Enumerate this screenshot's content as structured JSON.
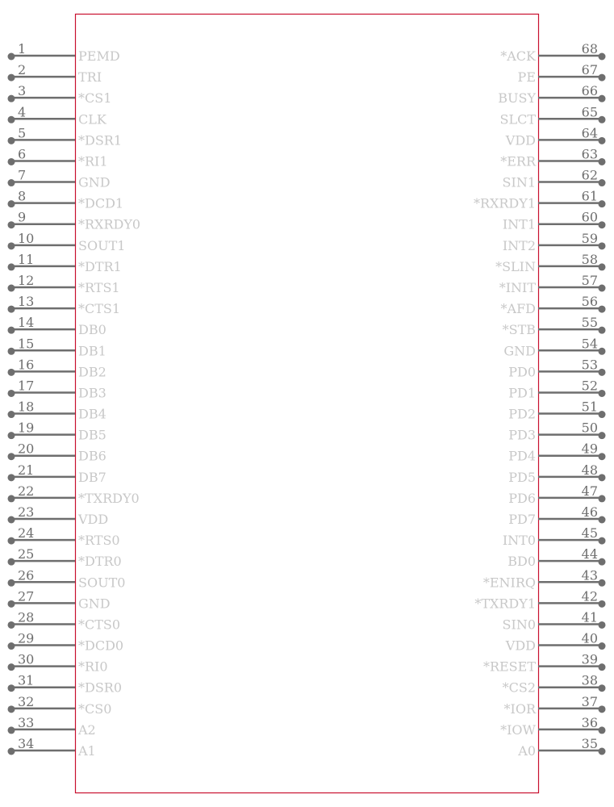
{
  "component": {
    "body_color": "#c8102e",
    "pin_color": "#6e6e6e",
    "label_color": "#c8c8c8",
    "left_pins": [
      {
        "num": "1",
        "name": "PEMD"
      },
      {
        "num": "2",
        "name": "TRI"
      },
      {
        "num": "3",
        "name": "*CS1"
      },
      {
        "num": "4",
        "name": "CLK"
      },
      {
        "num": "5",
        "name": "*DSR1"
      },
      {
        "num": "6",
        "name": "*RI1"
      },
      {
        "num": "7",
        "name": "GND"
      },
      {
        "num": "8",
        "name": "*DCD1"
      },
      {
        "num": "9",
        "name": "*RXRDY0"
      },
      {
        "num": "10",
        "name": "SOUT1"
      },
      {
        "num": "11",
        "name": "*DTR1"
      },
      {
        "num": "12",
        "name": "*RTS1"
      },
      {
        "num": "13",
        "name": "*CTS1"
      },
      {
        "num": "14",
        "name": "DB0"
      },
      {
        "num": "15",
        "name": "DB1"
      },
      {
        "num": "16",
        "name": "DB2"
      },
      {
        "num": "17",
        "name": "DB3"
      },
      {
        "num": "18",
        "name": "DB4"
      },
      {
        "num": "19",
        "name": "DB5"
      },
      {
        "num": "20",
        "name": "DB6"
      },
      {
        "num": "21",
        "name": "DB7"
      },
      {
        "num": "22",
        "name": "*TXRDY0"
      },
      {
        "num": "23",
        "name": "VDD"
      },
      {
        "num": "24",
        "name": "*RTS0"
      },
      {
        "num": "25",
        "name": "*DTR0"
      },
      {
        "num": "26",
        "name": "SOUT0"
      },
      {
        "num": "27",
        "name": "GND"
      },
      {
        "num": "28",
        "name": "*CTS0"
      },
      {
        "num": "29",
        "name": "*DCD0"
      },
      {
        "num": "30",
        "name": "*RI0"
      },
      {
        "num": "31",
        "name": "*DSR0"
      },
      {
        "num": "32",
        "name": "*CS0"
      },
      {
        "num": "33",
        "name": "A2"
      },
      {
        "num": "34",
        "name": "A1"
      }
    ],
    "right_pins": [
      {
        "num": "68",
        "name": "*ACK"
      },
      {
        "num": "67",
        "name": "PE"
      },
      {
        "num": "66",
        "name": "BUSY"
      },
      {
        "num": "65",
        "name": "SLCT"
      },
      {
        "num": "64",
        "name": "VDD"
      },
      {
        "num": "63",
        "name": "*ERR"
      },
      {
        "num": "62",
        "name": "SIN1"
      },
      {
        "num": "61",
        "name": "*RXRDY1"
      },
      {
        "num": "60",
        "name": "INT1"
      },
      {
        "num": "59",
        "name": "INT2"
      },
      {
        "num": "58",
        "name": "*SLIN"
      },
      {
        "num": "57",
        "name": "*INIT"
      },
      {
        "num": "56",
        "name": "*AFD"
      },
      {
        "num": "55",
        "name": "*STB"
      },
      {
        "num": "54",
        "name": "GND"
      },
      {
        "num": "53",
        "name": "PD0"
      },
      {
        "num": "52",
        "name": "PD1"
      },
      {
        "num": "51",
        "name": "PD2"
      },
      {
        "num": "50",
        "name": "PD3"
      },
      {
        "num": "49",
        "name": "PD4"
      },
      {
        "num": "48",
        "name": "PD5"
      },
      {
        "num": "47",
        "name": "PD6"
      },
      {
        "num": "46",
        "name": "PD7"
      },
      {
        "num": "45",
        "name": "INT0"
      },
      {
        "num": "44",
        "name": "BD0"
      },
      {
        "num": "43",
        "name": "*ENIRQ"
      },
      {
        "num": "42",
        "name": "*TXRDY1"
      },
      {
        "num": "41",
        "name": "SIN0"
      },
      {
        "num": "40",
        "name": "VDD"
      },
      {
        "num": "39",
        "name": "*RESET"
      },
      {
        "num": "38",
        "name": "*CS2"
      },
      {
        "num": "37",
        "name": "*IOR"
      },
      {
        "num": "36",
        "name": "*IOW"
      },
      {
        "num": "35",
        "name": "A0"
      }
    ]
  }
}
